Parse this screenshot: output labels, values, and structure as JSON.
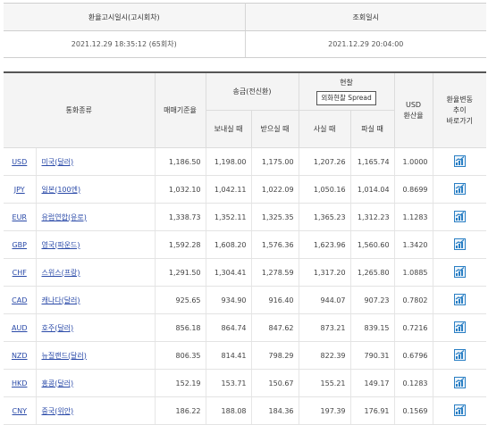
{
  "info": {
    "announce_label": "환율고시일시(고시회차)",
    "query_label": "조회일시",
    "announce_value": "2021.12.29 18:35:12 (65회차)",
    "query_value": "2021.12.29 20:04:00"
  },
  "headers": {
    "currency_type": "통화종류",
    "base_rate": "매매기준율",
    "remit": "송금(전신환)",
    "cash": "현찰",
    "spread_button": "외화현찰 Spread",
    "usd_line1": "USD",
    "usd_line2": "환산율",
    "trend_line1": "환율변동",
    "trend_line2": "추이",
    "trend_line3": "바로가기",
    "send": "보내실 때",
    "receive": "받으실 때",
    "buy": "사실 때",
    "sell": "파실 때"
  },
  "rows": [
    {
      "code": "USD",
      "name": "미국(달러)",
      "base": "1,186.50",
      "send": "1,198.00",
      "receive": "1,175.00",
      "buy": "1,207.26",
      "sell": "1,165.74",
      "usd": "1.0000"
    },
    {
      "code": "JPY",
      "name": "일본(100엔)",
      "base": "1,032.10",
      "send": "1,042.11",
      "receive": "1,022.09",
      "buy": "1,050.16",
      "sell": "1,014.04",
      "usd": "0.8699"
    },
    {
      "code": "EUR",
      "name": "유럽연합(유로)",
      "base": "1,338.73",
      "send": "1,352.11",
      "receive": "1,325.35",
      "buy": "1,365.23",
      "sell": "1,312.23",
      "usd": "1.1283"
    },
    {
      "code": "GBP",
      "name": "영국(파운드)",
      "base": "1,592.28",
      "send": "1,608.20",
      "receive": "1,576.36",
      "buy": "1,623.96",
      "sell": "1,560.60",
      "usd": "1.3420"
    },
    {
      "code": "CHF",
      "name": "스위스(프랑)",
      "base": "1,291.50",
      "send": "1,304.41",
      "receive": "1,278.59",
      "buy": "1,317.20",
      "sell": "1,265.80",
      "usd": "1.0885"
    },
    {
      "code": "CAD",
      "name": "캐나다(달러)",
      "base": "925.65",
      "send": "934.90",
      "receive": "916.40",
      "buy": "944.07",
      "sell": "907.23",
      "usd": "0.7802"
    },
    {
      "code": "AUD",
      "name": "호주(달러)",
      "base": "856.18",
      "send": "864.74",
      "receive": "847.62",
      "buy": "873.21",
      "sell": "839.15",
      "usd": "0.7216"
    },
    {
      "code": "NZD",
      "name": "뉴질랜드(달러)",
      "base": "806.35",
      "send": "814.41",
      "receive": "798.29",
      "buy": "822.39",
      "sell": "790.31",
      "usd": "0.6796"
    },
    {
      "code": "HKD",
      "name": "홍콩(달러)",
      "base": "152.19",
      "send": "153.71",
      "receive": "150.67",
      "buy": "155.21",
      "sell": "149.17",
      "usd": "0.1283"
    },
    {
      "code": "CNY",
      "name": "중국(위안)",
      "base": "186.22",
      "send": "188.08",
      "receive": "184.36",
      "buy": "197.39",
      "sell": "176.91",
      "usd": "0.1569"
    }
  ],
  "icons": {
    "trend": "chart-trend-icon"
  },
  "colors": {
    "link": "#2a4aa8",
    "icon": "#2a7fc4"
  }
}
